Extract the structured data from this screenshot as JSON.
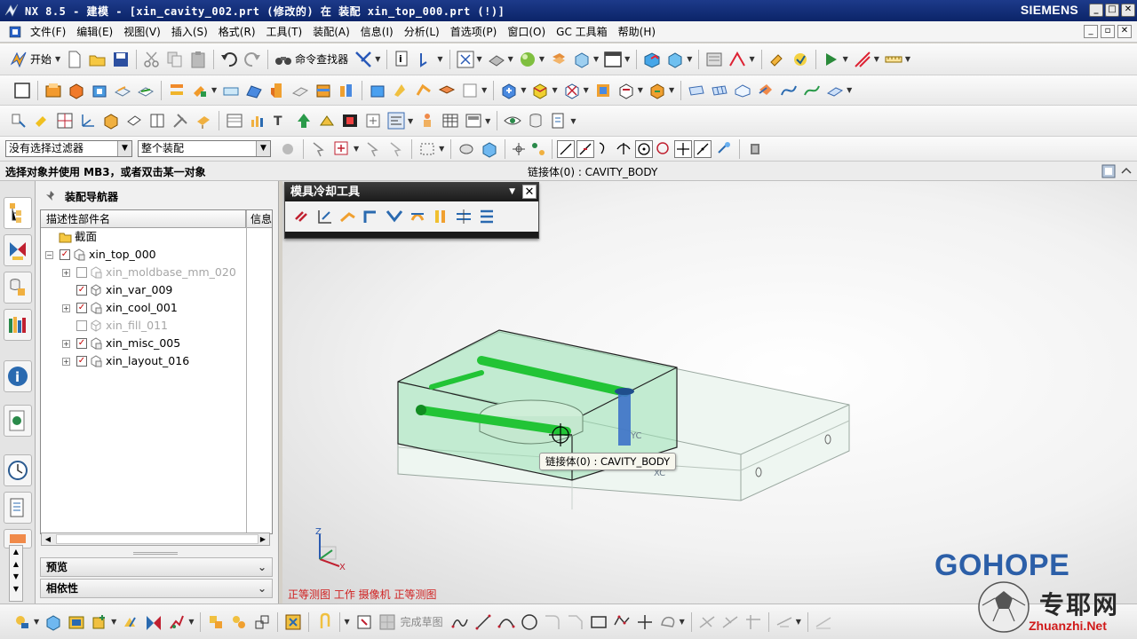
{
  "window": {
    "title": "NX 8.5 - 建模 - [xin_cavity_002.prt (修改的)  在 装配 xin_top_000.prt   (!)]",
    "brand": "SIEMENS",
    "min": "_",
    "max": "□",
    "close": "✕"
  },
  "menubar": {
    "items": [
      "文件(F)",
      "编辑(E)",
      "视图(V)",
      "插入(S)",
      "格式(R)",
      "工具(T)",
      "装配(A)",
      "信息(I)",
      "分析(L)",
      "首选项(P)",
      "窗口(O)",
      "GC 工具箱",
      "帮助(H)"
    ]
  },
  "toolbar": {
    "start_label": "开始",
    "command_finder_label": "命令查找器"
  },
  "selection_bar": {
    "filter": "没有选择过滤器",
    "scope": "整个装配"
  },
  "cue_line": {
    "prompt": "选择对象并使用 MB3，或者双击某一对象",
    "status": "链接体(0) : CAVITY_BODY"
  },
  "navigator": {
    "title": "装配导航器",
    "col_name": "描述性部件名",
    "col_info": "信息",
    "rows": [
      {
        "label": "截面",
        "checked": false,
        "dim": false
      },
      {
        "label": "xin_top_000",
        "checked": true,
        "dim": false
      },
      {
        "label": "xin_moldbase_mm_020",
        "checked": false,
        "dim": true
      },
      {
        "label": "xin_var_009",
        "checked": true,
        "dim": false
      },
      {
        "label": "xin_cool_001",
        "checked": true,
        "dim": false
      },
      {
        "label": "xin_fill_011",
        "checked": false,
        "dim": true
      },
      {
        "label": "xin_misc_005",
        "checked": true,
        "dim": false
      },
      {
        "label": "xin_layout_016",
        "checked": true,
        "dim": false
      }
    ],
    "panels": [
      "预览",
      "相依性"
    ]
  },
  "mold_tool": {
    "title": "模具冷却工具"
  },
  "graphics": {
    "view_label": "正等测图 工作 摄像机 正等测图",
    "tooltip": "链接体(0) : CAVITY_BODY",
    "axes": {
      "x": "X",
      "y": "Y",
      "z": "Z"
    },
    "model_labels": {
      "yc": "YC",
      "xc": "XC"
    },
    "logo": "GOHOPE"
  },
  "bottom_toolbar": {
    "finish_sketch": "完成草图"
  },
  "watermark": {
    "cn": "专耶网",
    "site": "Zhuanzhi.Net"
  },
  "colors": {
    "titlebar": "#0b2468",
    "mold_green": "#22c436",
    "view_label": "#d02020",
    "logo": "#2c5fa8"
  }
}
